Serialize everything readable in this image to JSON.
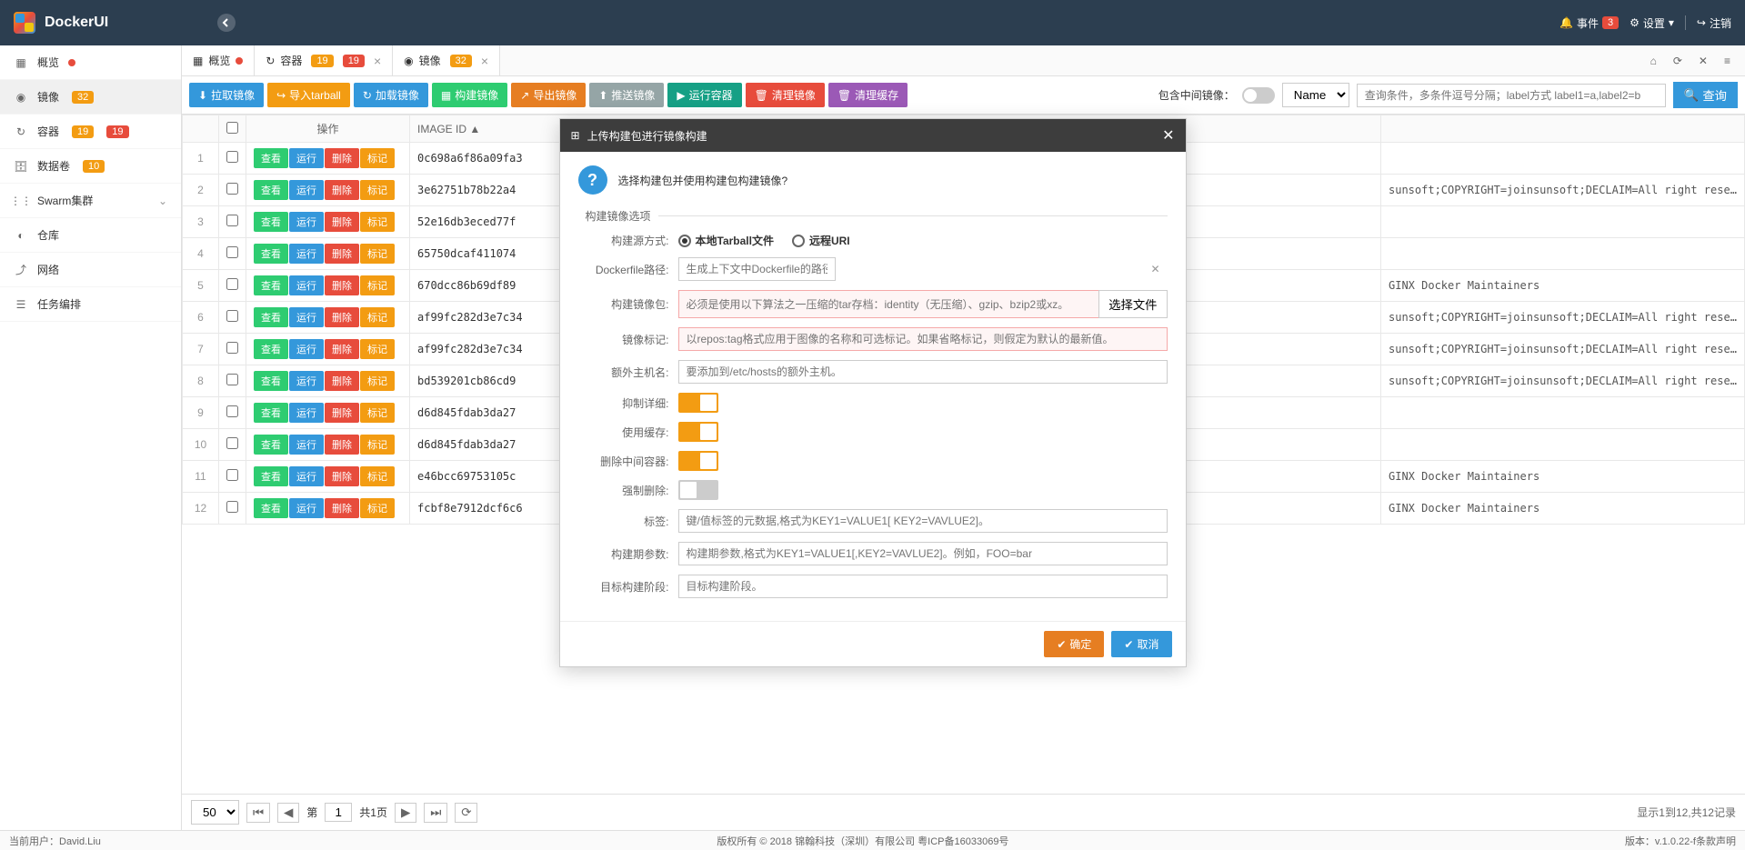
{
  "app_title": "DockerUI",
  "header": {
    "events_label": "事件",
    "events_count": "3",
    "settings_label": "设置",
    "logout_label": "注销"
  },
  "sidebar": {
    "items": [
      {
        "label": "概览",
        "icon": "grid",
        "badges": [],
        "dot": true
      },
      {
        "label": "镜像",
        "icon": "disc",
        "badges": [
          "32"
        ],
        "active": true
      },
      {
        "label": "容器",
        "icon": "refresh",
        "badges": [
          "19",
          "19"
        ]
      },
      {
        "label": "数据卷",
        "icon": "database",
        "badges": [
          "10"
        ]
      },
      {
        "label": "Swarm集群",
        "icon": "nodes",
        "chevron": true
      },
      {
        "label": "仓库",
        "icon": "dashboard"
      },
      {
        "label": "网络",
        "icon": "share"
      },
      {
        "label": "任务编排",
        "icon": "tasks"
      }
    ]
  },
  "tabs": [
    {
      "label": "概览",
      "icon": "grid",
      "dot": true
    },
    {
      "label": "容器",
      "icon": "refresh",
      "badges": [
        "19",
        "19"
      ],
      "closable": true
    },
    {
      "label": "镜像",
      "icon": "disc",
      "badges": [
        "32"
      ],
      "closable": true,
      "active": true
    }
  ],
  "toolbar": {
    "pull": "拉取镜像",
    "import": "导入tarball",
    "load": "加载镜像",
    "build": "构建镜像",
    "export": "导出镜像",
    "push": "推送镜像",
    "run": "运行容器",
    "clean_image": "清理镜像",
    "clean_cache": "清理缓存",
    "include_intermediate": "包含中间镜像：",
    "search_by": "Name",
    "search_placeholder": "查询条件，多条件逗号分隔；label方式 label1=a,label2=b",
    "search_btn": "查询"
  },
  "table": {
    "headers": {
      "action": "操作",
      "image_id": "IMAGE ID"
    },
    "actions": {
      "view": "查看",
      "run": "运行",
      "delete": "删除",
      "tag": "标记"
    },
    "rows": [
      {
        "n": 1,
        "id": "0c698a6f86a09fa3",
        "labels": ""
      },
      {
        "n": 2,
        "id": "3e62751b78b22a4",
        "labels": "sunsoft;COPYRIGHT=joinsunsoft;DECLAIM=All right reserved"
      },
      {
        "n": 3,
        "id": "52e16db3eced77f",
        "labels": ""
      },
      {
        "n": 4,
        "id": "65750dcaf411074",
        "labels": ""
      },
      {
        "n": 5,
        "id": "670dcc86b69df89",
        "labels": "GINX Docker Maintainers"
      },
      {
        "n": 6,
        "id": "af99fc282d3e7c34",
        "labels": "sunsoft;COPYRIGHT=joinsunsoft;DECLAIM=All right reserved"
      },
      {
        "n": 7,
        "id": "af99fc282d3e7c34",
        "labels": "sunsoft;COPYRIGHT=joinsunsoft;DECLAIM=All right reserved"
      },
      {
        "n": 8,
        "id": "bd539201cb86cd9",
        "labels": "sunsoft;COPYRIGHT=joinsunsoft;DECLAIM=All right reserved"
      },
      {
        "n": 9,
        "id": "d6d845fdab3da27",
        "labels": ""
      },
      {
        "n": 10,
        "id": "d6d845fdab3da27",
        "labels": ""
      },
      {
        "n": 11,
        "id": "e46bcc69753105c",
        "labels": "GINX Docker Maintainers"
      },
      {
        "n": 12,
        "id": "fcbf8e7912dcf6c6",
        "labels": "GINX Docker Maintainers"
      }
    ]
  },
  "pagination": {
    "page_size": "50",
    "page_label_prefix": "第",
    "page_current": "1",
    "page_total": "共1页",
    "summary": "显示1到12,共12记录"
  },
  "footer": {
    "user": "当前用户：David.Liu",
    "copyright": "版权所有 © 2018 锦翰科技（深圳）有限公司 粤ICP备16033069号",
    "version": "版本：v.1.0.22-f条款声明"
  },
  "modal": {
    "title": "上传构建包进行镜像构建",
    "question": "选择构建包并使用构建包构建镜像?",
    "fieldset_title": "构建镜像选项",
    "fields": {
      "source_type": {
        "label": "构建源方式:",
        "option1": "本地Tarball文件",
        "option2": "远程URI"
      },
      "dockerfile_path": {
        "label": "Dockerfile路径:",
        "placeholder": "生成上下文中Dockerfile的路径。默认为Dockerfile。"
      },
      "build_package": {
        "label": "构建镜像包:",
        "placeholder": "必须是使用以下算法之一压缩的tar存档：identity（无压缩）、gzip、bzip2或xz。",
        "btn": "选择文件"
      },
      "image_tag": {
        "label": "镜像标记:",
        "placeholder": "以repos:tag格式应用于图像的名称和可选标记。如果省略标记，则假定为默认的最新值。"
      },
      "extra_host": {
        "label": "额外主机名:",
        "placeholder": "要添加到/etc/hosts的额外主机。"
      },
      "suppress_verbose": {
        "label": "抑制详细:"
      },
      "use_cache": {
        "label": "使用缓存:"
      },
      "remove_intermediate": {
        "label": "删除中间容器:"
      },
      "force_remove": {
        "label": "强制删除:"
      },
      "labels": {
        "label": "标签:",
        "placeholder": "键/值标签的元数据,格式为KEY1=VALUE1[ KEY2=VAVLUE2]。"
      },
      "build_args": {
        "label": "构建期参数:",
        "placeholder": "构建期参数,格式为KEY1=VALUE1[,KEY2=VAVLUE2]。例如，FOO=bar"
      },
      "target_stage": {
        "label": "目标构建阶段:",
        "placeholder": "目标构建阶段。"
      }
    },
    "confirm": "确定",
    "cancel": "取消"
  }
}
